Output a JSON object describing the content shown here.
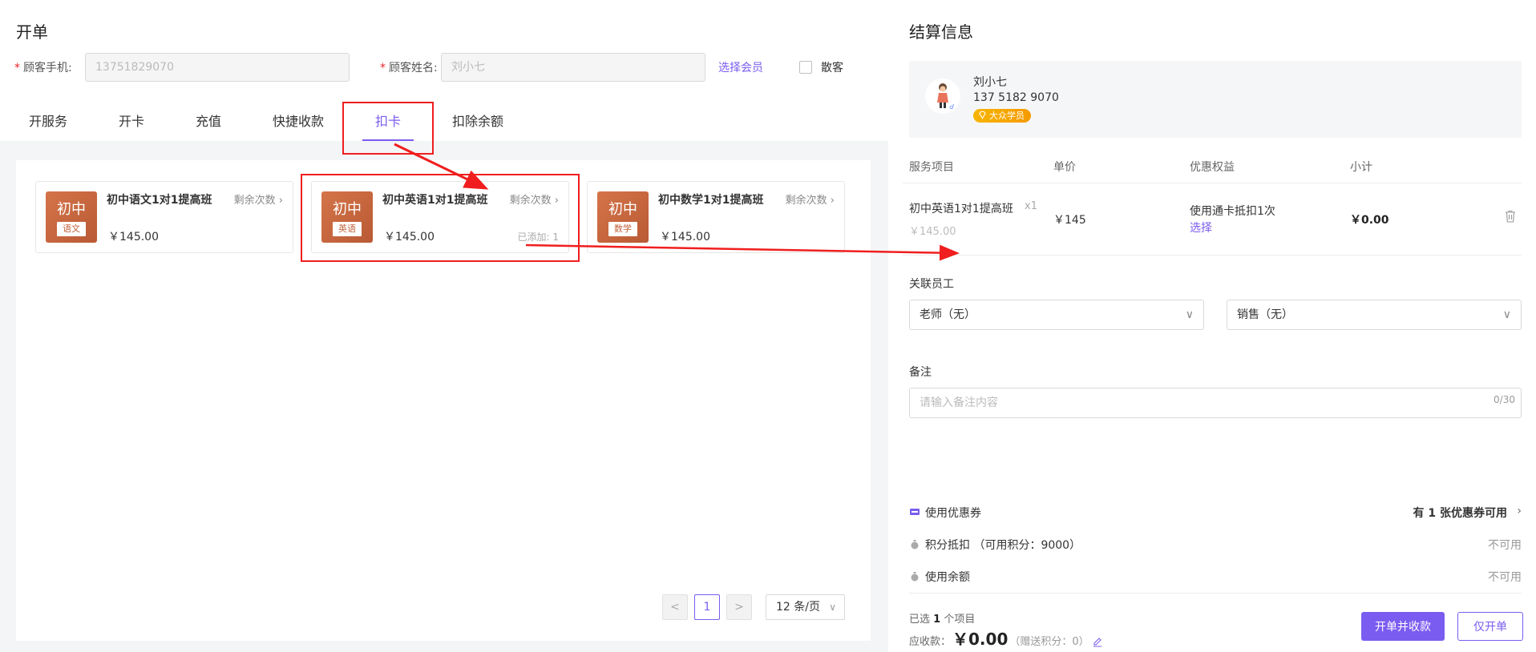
{
  "left": {
    "title": "开单",
    "phone_label": "顾客手机:",
    "phone_value": "13751829070",
    "name_label": "顾客姓名:",
    "name_value": "刘小七",
    "select_member": "选择会员",
    "walk_in": "散客",
    "tabs": [
      "开服务",
      "开卡",
      "充值",
      "快捷收款",
      "扣卡",
      "扣除余额"
    ],
    "active_tab": "扣卡",
    "cards": [
      {
        "name": "初中语文1对1提高班",
        "thumb_main": "初中",
        "thumb_sub": "语文",
        "remain": "剩余次数",
        "price": "￥145.00",
        "added": ""
      },
      {
        "name": "初中英语1对1提高班",
        "thumb_main": "初中",
        "thumb_sub": "英语",
        "remain": "剩余次数",
        "price": "￥145.00",
        "added": "已添加: 1"
      },
      {
        "name": "初中数学1对1提高班",
        "thumb_main": "初中",
        "thumb_sub": "数学",
        "remain": "剩余次数",
        "price": "￥145.00",
        "added": ""
      }
    ],
    "pager": {
      "prev": "<",
      "page": "1",
      "next": ">",
      "page_size": "12 条/页"
    }
  },
  "right": {
    "title": "结算信息",
    "member": {
      "name": "刘小七",
      "phone": "137 5182 9070",
      "level": "大众学员"
    },
    "columns": [
      "服务项目",
      "单价",
      "优惠权益",
      "小计"
    ],
    "item": {
      "name": "初中英语1对1提高班",
      "qty": "x1",
      "orig_price": "￥145.00",
      "price": "￥145",
      "benefit": "使用通卡抵扣1次",
      "choose": "选择",
      "subtotal": "￥0.00"
    },
    "staff_label": "关联员工",
    "teacher": "老师（无）",
    "sales": "销售（无）",
    "remark_label": "备注",
    "remark_placeholder": "请输入备注内容",
    "remark_count": "0/30",
    "coupon_label": "使用优惠券",
    "coupon_value": "有 1 张优惠券可用",
    "points_label": "积分抵扣 （可用积分：9000）",
    "points_value": "不可用",
    "balance_label": "使用余额",
    "balance_value": "不可用",
    "selected_prefix": "已选",
    "selected_count": "1",
    "selected_suffix": "个项目",
    "due_label": "应收款：",
    "due_amount": "￥0.00",
    "gift_points": "（赠送积分：0）",
    "btn_checkout": "开单并收款",
    "btn_only": "仅开单"
  },
  "colors": {
    "accent": "#7b5cf0",
    "annotation": "#f01e1e",
    "badge": "#f7b500"
  }
}
